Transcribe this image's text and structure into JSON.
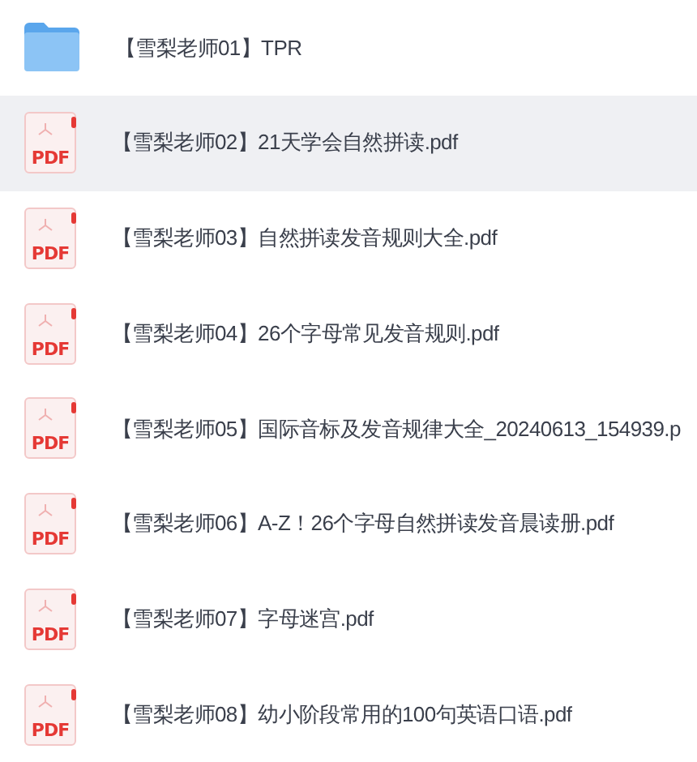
{
  "files": [
    {
      "kind": "folder",
      "name": "【雪梨老师01】TPR",
      "selected": false
    },
    {
      "kind": "pdf",
      "badge": "PDF",
      "name": "【雪梨老师02】21天学会自然拼读.pdf",
      "selected": true
    },
    {
      "kind": "pdf",
      "badge": "PDF",
      "name": "【雪梨老师03】自然拼读发音规则大全.pdf",
      "selected": false
    },
    {
      "kind": "pdf",
      "badge": "PDF",
      "name": "【雪梨老师04】26个字母常见发音规则.pdf",
      "selected": false
    },
    {
      "kind": "pdf",
      "badge": "PDF",
      "name": "【雪梨老师05】国际音标及发音规律大全_20240613_154939.p",
      "selected": false
    },
    {
      "kind": "pdf",
      "badge": "PDF",
      "name": "【雪梨老师06】A-Z！26个字母自然拼读发音晨读册.pdf",
      "selected": false
    },
    {
      "kind": "pdf",
      "badge": "PDF",
      "name": "【雪梨老师07】字母迷宫.pdf",
      "selected": false
    },
    {
      "kind": "pdf",
      "badge": "PDF",
      "name": "【雪梨老师08】幼小阶段常用的100句英语口语.pdf",
      "selected": false
    }
  ]
}
